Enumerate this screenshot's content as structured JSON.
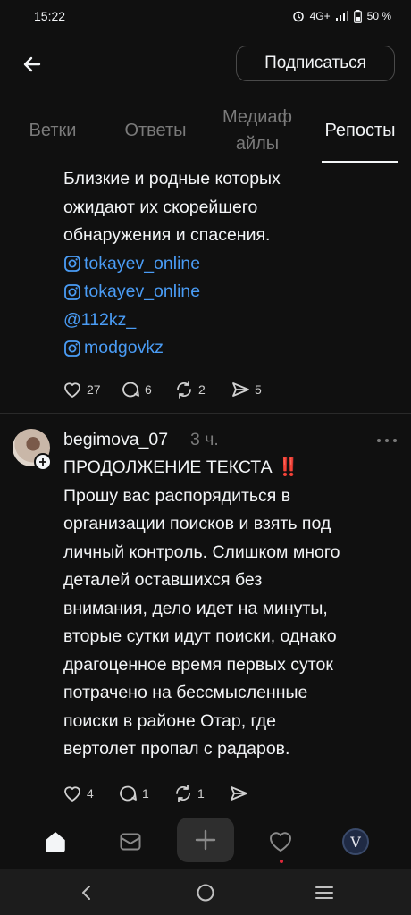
{
  "status_bar": {
    "time": "15:22",
    "network": "4G+",
    "battery": "50 %"
  },
  "header": {
    "subscribe_label": "Подписаться"
  },
  "tabs": [
    {
      "label": "Ветки",
      "active": false
    },
    {
      "label": "Ответы",
      "active": false
    },
    {
      "label": "Медиаф айлы",
      "active": false
    },
    {
      "label": "Репосты",
      "active": true
    }
  ],
  "post1": {
    "text_lines": [
      "Близкие и родные которых",
      "ожидают их скорейшего",
      "обнаружения и спасения."
    ],
    "links": [
      {
        "icon": "instagram-icon",
        "text": "tokayev_online"
      },
      {
        "icon": "instagram-icon",
        "text": "tokayev_online"
      },
      {
        "icon": "",
        "text": "@112kz_"
      },
      {
        "icon": "instagram-icon",
        "text": "modgovkz"
      }
    ],
    "likes": "27",
    "replies": "6",
    "reposts": "2",
    "shares": "5"
  },
  "post2": {
    "username": "begimova_07",
    "time": "3 ч.",
    "headline": "ПРОДОЛЖЕНИЕ ТЕКСТА",
    "headline_emoji": "‼️",
    "text_lines": [
      "Прошу вас распорядиться в",
      "организации поисков и взять под",
      "личный контроль. Слишком много",
      "деталей оставшихся без",
      "внимания, дело идет на минуты,",
      "вторые сутки идут поиски, однако",
      "драгоценное время первых суток",
      "потрачено на бессмысленные",
      "поиски в районе Отар, где",
      "вертолет пропал с радаров."
    ],
    "likes": "4",
    "replies": "1",
    "reposts": "1"
  },
  "bottom_nav": {
    "profile_initial": "V"
  },
  "colors": {
    "background": "#101010",
    "link": "#4a9cf5",
    "muted": "#7a7a7a",
    "alert": "#e0283a"
  }
}
